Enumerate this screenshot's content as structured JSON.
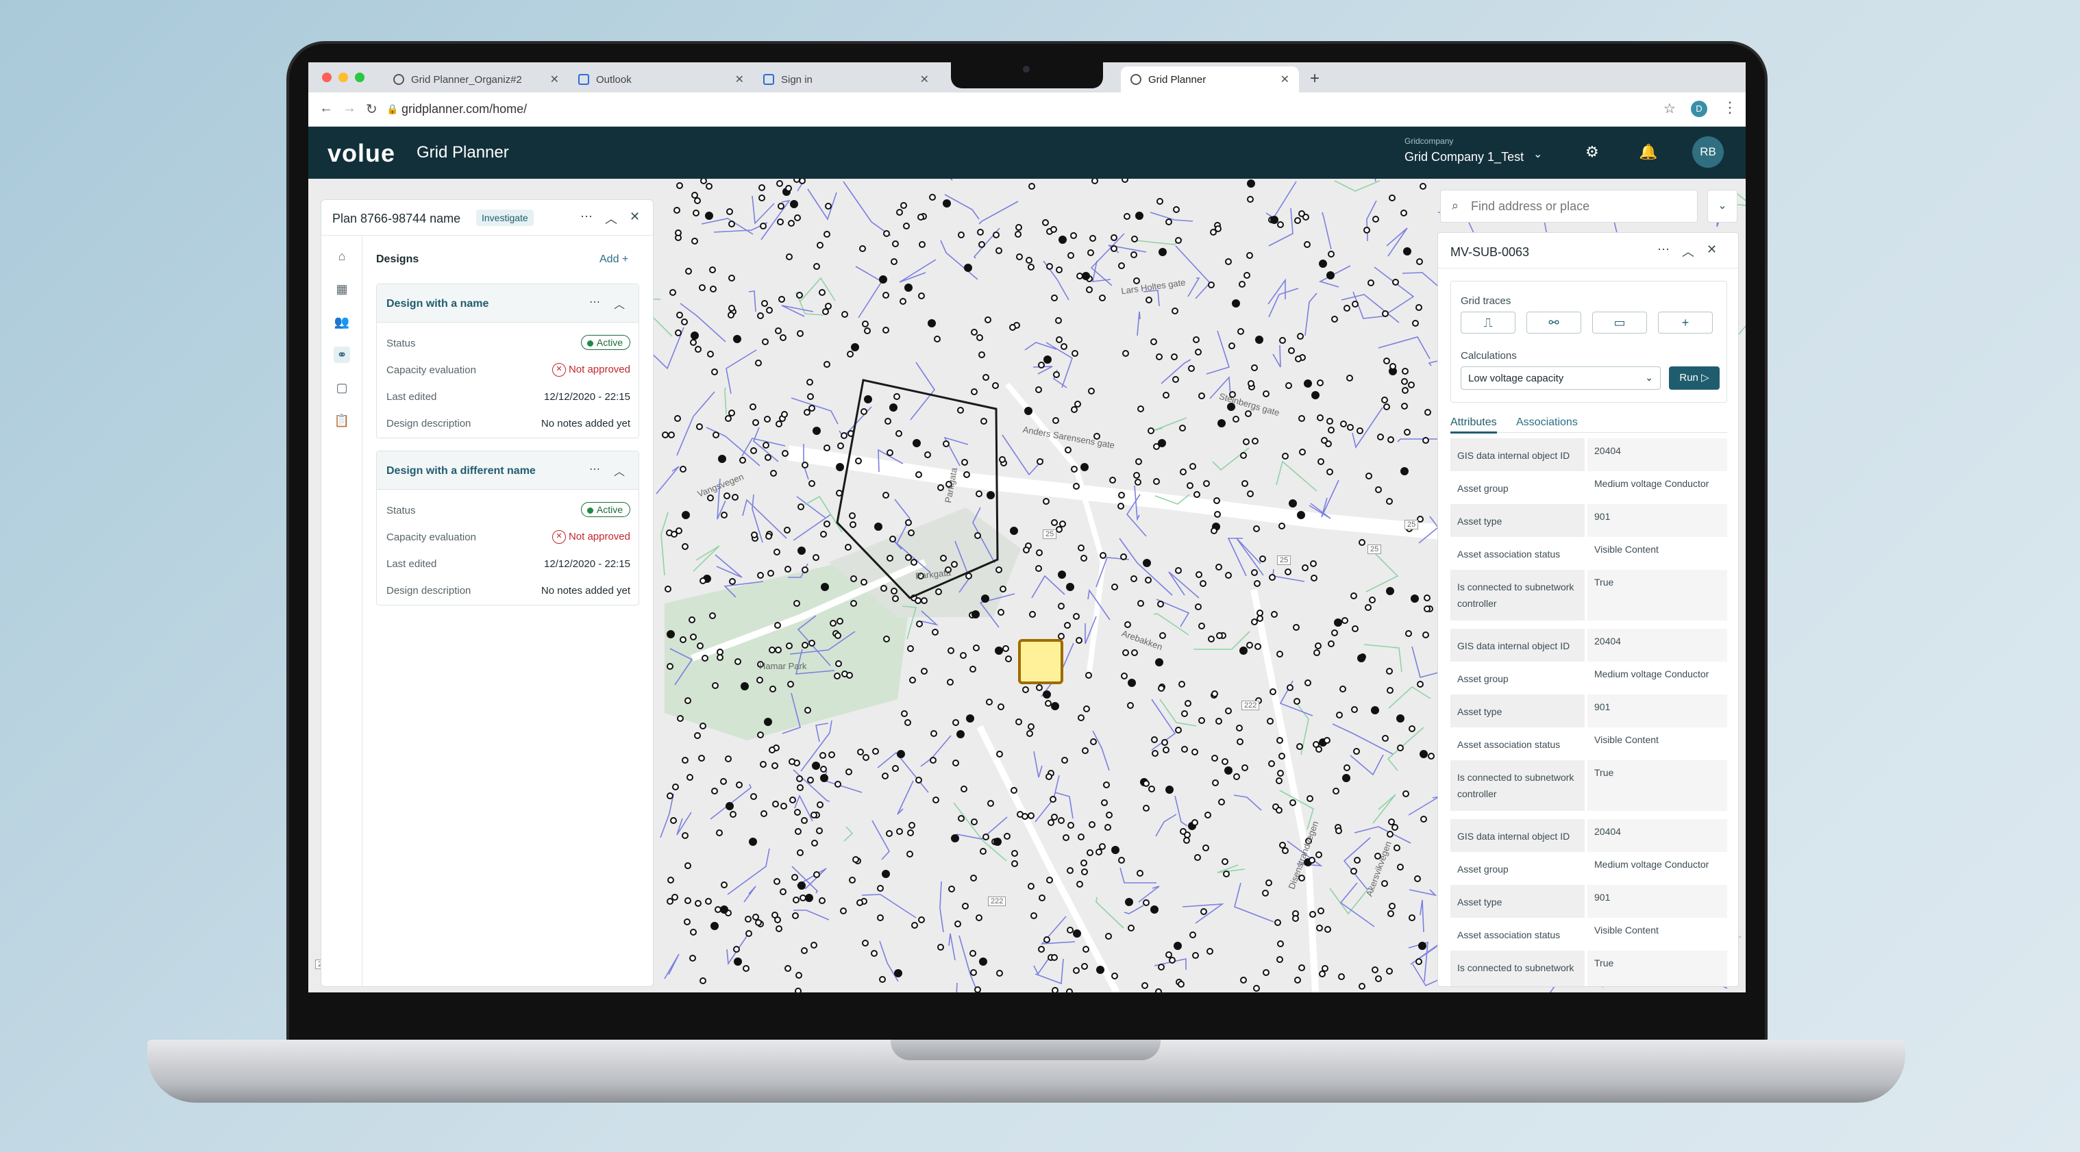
{
  "browser": {
    "tabs": [
      {
        "label": "Grid Planner_Organiz#2"
      },
      {
        "label": "Outlook"
      },
      {
        "label": "Sign in"
      },
      {
        "label": "Grid Planner"
      }
    ],
    "url": "gridplanner.com/home/",
    "profile_initial": "D"
  },
  "header": {
    "logo": "volue",
    "app_title": "Grid Planner",
    "company_caption": "Gridcompany",
    "company_name": "Grid Company 1_Test",
    "avatar_initials": "RB"
  },
  "left_panel": {
    "plan_title": "Plan 8766-98744 name",
    "plan_badge": "Investigate",
    "section_title": "Designs",
    "add_label": "Add +",
    "designs": [
      {
        "title": "Design with a name",
        "status_label": "Status",
        "status_value": "Active",
        "capacity_label": "Capacity evaluation",
        "capacity_value": "Not approved",
        "edited_label": "Last edited",
        "edited_value": "12/12/2020 - 22:15",
        "desc_label": "Design description",
        "desc_value": "No notes added yet"
      },
      {
        "title": "Design with a different name",
        "status_label": "Status",
        "status_value": "Active",
        "capacity_label": "Capacity evaluation",
        "capacity_value": "Not approved",
        "edited_label": "Last edited",
        "edited_value": "12/12/2020 - 22:15",
        "desc_label": "Design description",
        "desc_value": "No notes added yet"
      }
    ]
  },
  "search": {
    "placeholder": "Find address or place"
  },
  "right_panel": {
    "title": "MV-SUB-0063",
    "grid_traces_label": "Grid traces",
    "calculations_label": "Calculations",
    "calc_selected": "Low voltage capacity",
    "run_label": "Run",
    "tabs": [
      "Attributes",
      "Associations"
    ],
    "attributes": [
      {
        "k": "GIS data internal object ID",
        "v": "20404"
      },
      {
        "k": "Asset group",
        "v": "Medium voltage Conductor"
      },
      {
        "k": "Asset type",
        "v": "901"
      },
      {
        "k": "Asset association status",
        "v": "Visible Content"
      },
      {
        "k": "Is connected to subnetwork controller",
        "v": "True"
      },
      {
        "k": "GIS data internal object ID",
        "v": "20404"
      },
      {
        "k": "Asset group",
        "v": "Medium voltage Conductor"
      },
      {
        "k": "Asset type",
        "v": "901"
      },
      {
        "k": "Asset association status",
        "v": "Visible Content"
      },
      {
        "k": "Is connected to subnetwork controller",
        "v": "True"
      },
      {
        "k": "GIS data internal object ID",
        "v": "20404"
      },
      {
        "k": "Asset group",
        "v": "Medium voltage Conductor"
      },
      {
        "k": "Asset type",
        "v": "901"
      },
      {
        "k": "Asset association status",
        "v": "Visible Content"
      },
      {
        "k": "Is connected to subnetwork",
        "v": "True"
      }
    ]
  },
  "map": {
    "labels": {
      "park1": "Parkgata",
      "park2": "Parkgata",
      "hamar": "Hamar Park",
      "street1": "Vangsvegen",
      "street2": "Anders Sarensens gate",
      "street3": "Steinbergs gate",
      "street4": "Lars Holtes gate",
      "street5": "Arebakken",
      "street6": "Disenstrandvegen",
      "street7": "Akersvikvegen",
      "road1": "25",
      "road2": "25",
      "road3": "25",
      "road4": "25",
      "road5": "25",
      "road6": "222",
      "road7": "222",
      "road8": "222"
    },
    "colors": {
      "grid_lines": "#7b7fe0",
      "streets": "#ffffff",
      "paths": "#8fd3a4",
      "park": "#d3e4d2",
      "highlight_fill": "#fff19a",
      "highlight_stroke": "#a06a00"
    }
  }
}
